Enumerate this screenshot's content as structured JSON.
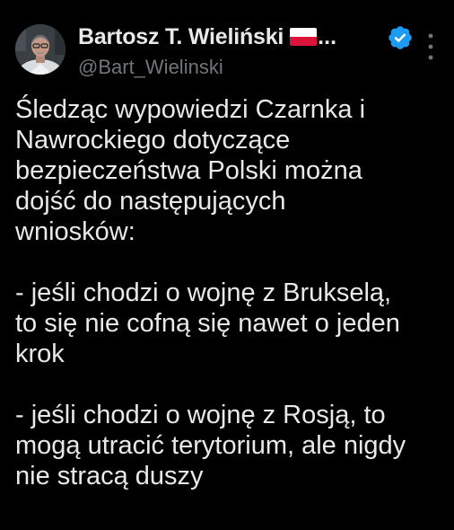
{
  "author": {
    "display_name": "Bartosz T. Wieliński",
    "name_truncation": "...",
    "handle": "@Bart_Wielinski",
    "flag_icon": "poland-flag-icon",
    "verified_icon": "verified-badge-icon",
    "more_icon": "more-vertical-icon"
  },
  "colors": {
    "background": "#000000",
    "text": "#e7e9ea",
    "secondary_text": "#71767b",
    "verified_blue": "#1d9bf0"
  },
  "tweet": {
    "lines": [
      "Śledząc wypowiedzi Czarnka i",
      "Nawrockiego dotyczące",
      "bezpieczeństwa Polski można",
      "dojść do następujących",
      "wniosków:",
      "",
      "- jeśli chodzi o wojnę z Brukselą,",
      "to się nie cofną się nawet o jeden",
      "krok",
      "",
      "- jeśli chodzi o wojnę z Rosją, to",
      "mogą utracić terytorium, ale nigdy",
      "nie stracą duszy"
    ]
  }
}
